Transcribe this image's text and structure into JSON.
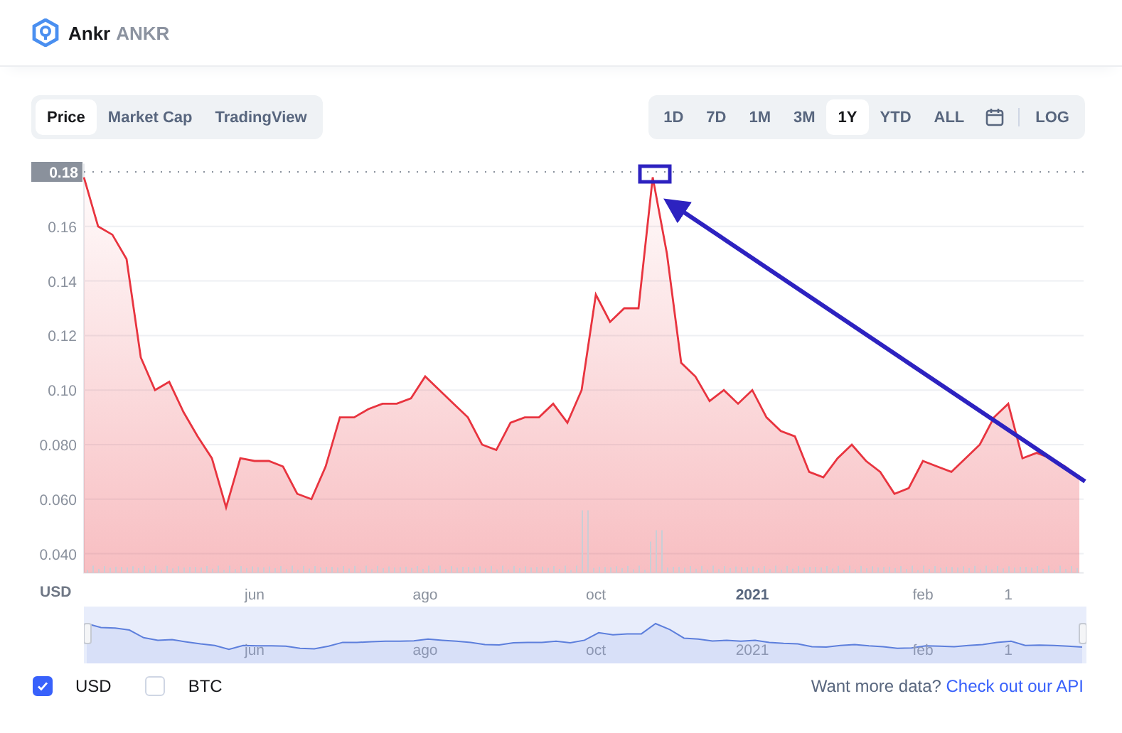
{
  "header": {
    "name": "Ankr",
    "symbol": "ANKR"
  },
  "chart_tabs": [
    {
      "label": "Price",
      "selected": true
    },
    {
      "label": "Market Cap",
      "selected": false
    },
    {
      "label": "TradingView",
      "selected": false
    }
  ],
  "ranges": [
    {
      "label": "1D",
      "selected": false
    },
    {
      "label": "7D",
      "selected": false
    },
    {
      "label": "1M",
      "selected": false
    },
    {
      "label": "3M",
      "selected": false
    },
    {
      "label": "1Y",
      "selected": true
    },
    {
      "label": "YTD",
      "selected": false
    },
    {
      "label": "ALL",
      "selected": false
    }
  ],
  "log_button": "LOG",
  "chart_data": {
    "type": "area",
    "categories": [
      null,
      null,
      null,
      null,
      null,
      null,
      null,
      null,
      null,
      null,
      null,
      null,
      "jun",
      null,
      null,
      null,
      null,
      null,
      null,
      null,
      null,
      null,
      null,
      null,
      "ago",
      null,
      null,
      null,
      null,
      null,
      null,
      null,
      null,
      null,
      null,
      null,
      "oct",
      null,
      null,
      null,
      null,
      null,
      null,
      null,
      null,
      null,
      null,
      "2021",
      null,
      null,
      null,
      null,
      null,
      null,
      null,
      null,
      null,
      null,
      null,
      "feb",
      null,
      null,
      null,
      null,
      null,
      "1",
      null,
      null,
      null,
      null,
      null
    ],
    "series": [
      {
        "name": "USD",
        "color": "#e8343f",
        "values": [
          0.178,
          0.16,
          0.157,
          0.148,
          0.112,
          0.1,
          0.103,
          0.092,
          0.083,
          0.075,
          0.057,
          0.075,
          0.074,
          0.074,
          0.072,
          0.062,
          0.06,
          0.072,
          0.09,
          0.09,
          0.093,
          0.095,
          0.095,
          0.097,
          0.105,
          0.1,
          0.095,
          0.09,
          0.08,
          0.078,
          0.088,
          0.09,
          0.09,
          0.095,
          0.088,
          0.1,
          0.135,
          0.125,
          0.13,
          0.13,
          0.178,
          0.15,
          0.11,
          0.105,
          0.096,
          0.1,
          0.095,
          0.1,
          0.09,
          0.085,
          0.083,
          0.07,
          0.068,
          0.075,
          0.08,
          0.074,
          0.07,
          0.062,
          0.064,
          0.074,
          0.072,
          0.07,
          0.075,
          0.08,
          0.09,
          0.095,
          0.075,
          0.077,
          0.075,
          0.072,
          0.068
        ]
      }
    ],
    "ylim": [
      0.033,
      0.183
    ],
    "grid": true,
    "yticks": [
      {
        "value": 0.04,
        "label": "0.040"
      },
      {
        "value": 0.06,
        "label": "0.060"
      },
      {
        "value": 0.08,
        "label": "0.080"
      },
      {
        "value": 0.1,
        "label": "0.10"
      },
      {
        "value": 0.12,
        "label": "0.12"
      },
      {
        "value": 0.14,
        "label": "0.14"
      },
      {
        "value": 0.16,
        "label": "0.16"
      }
    ]
  },
  "overlays": [
    {
      "kind": "price_tag",
      "label": "0.18"
    },
    {
      "kind": "highlight_box",
      "color": "#2d22c0"
    },
    {
      "kind": "arrow",
      "color": "#2d22c0"
    }
  ],
  "navigator": {
    "labels": [
      "jun",
      "ago",
      "oct",
      "2021",
      "feb",
      "1"
    ]
  },
  "currencies": [
    {
      "label": "USD",
      "checked": true
    },
    {
      "label": "BTC",
      "checked": false
    }
  ],
  "footer": {
    "prompt": "Want more data?",
    "link": "Check out our API"
  }
}
